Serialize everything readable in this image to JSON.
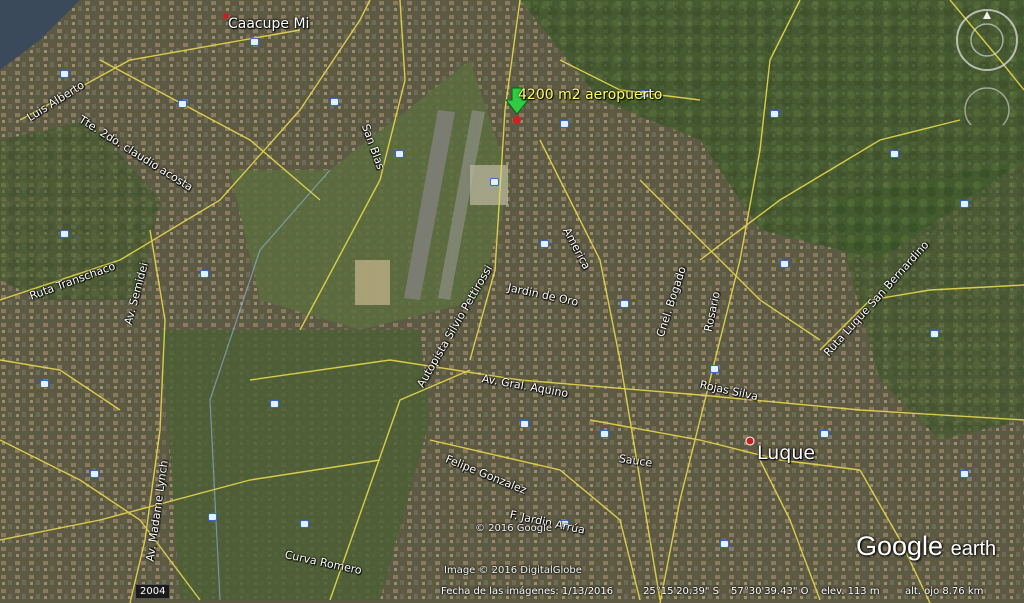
{
  "pin": {
    "label": "4200 m2 aeropuerto",
    "color": "#2ecc40"
  },
  "places": {
    "caacupe": "Caacupe Mi",
    "luque": "Luque"
  },
  "roads": {
    "luis_alberto": "Luis Alberto",
    "tte_ortiz": "Tte. 2do. claudio acosta",
    "san_blas": "San Blas",
    "ruta_transchaco": "Ruta Transchaco",
    "av_semidei": "Av. Semidei",
    "america": "America",
    "jardin_de_oro": "Jardin de Oro",
    "autopista": "Autopista Silvio Pettirossi",
    "cnel_bogado": "Cnel. Bogado",
    "rosario": "Rosario",
    "ruta_luque": "Ruta Luque San Bernardino",
    "av_aquino": "Av. Gral. Aquino",
    "rojas_silva": "Rojas Silva",
    "madame_lynch": "Av. Madame Lynch",
    "felipe_gonzalez": "Felipe Gonzalez",
    "sauce": "Sauce",
    "arrua": "F. Jardin Arrúa",
    "curva_romero": "Curva Romero"
  },
  "credits": {
    "google_copyright": "© 2016 Google",
    "image_copyright": "Image © 2016 DigitalGlobe"
  },
  "logo": {
    "google": "Google",
    "earth": "earth"
  },
  "history_badge": "2004",
  "status_bar": {
    "imagery_date": "Fecha de las imágenes: 1/13/2016",
    "lat": "25°15'20.39\" S",
    "lon": "57°30'39.43\" O",
    "elev": "elev.  113 m",
    "eye_alt": "alt. ojo   8.76 km"
  },
  "colors": {
    "road": "#e8d84a",
    "river": "#3a4a5a",
    "terrain": "#3d4a2e"
  }
}
